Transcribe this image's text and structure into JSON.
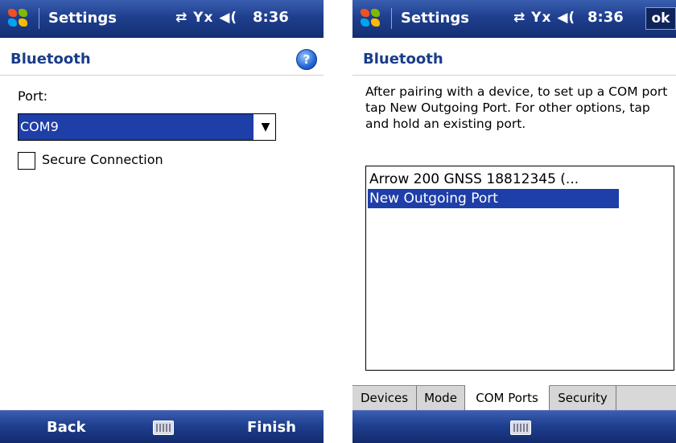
{
  "left": {
    "title": "Settings",
    "status_icons": "⇄ Yx ◀(",
    "time": "8:36",
    "section_title": "Bluetooth",
    "help_label": "?",
    "port_label": "Port:",
    "port_value": "COM9",
    "secure_label": "Secure Connection",
    "softkey_left": "Back",
    "softkey_right": "Finish"
  },
  "right": {
    "title": "Settings",
    "status_icons": "⇄ Yx ◀(",
    "time": "8:36",
    "ok_label": "ok",
    "section_title": "Bluetooth",
    "description": "After pairing with a device, to set up a COM port tap New Outgoing Port. For other options, tap and hold an existing port.",
    "list_items": [
      "Arrow 200 GNSS 18812345 (...",
      "New Outgoing Port"
    ],
    "tabs": [
      "Devices",
      "Mode",
      "COM Ports",
      "Security"
    ],
    "active_tab": "COM Ports"
  },
  "colors": {
    "titlebar": "#1f3f8f",
    "selection": "#1e3ea8",
    "heading": "#1a3d8a"
  },
  "icons": {
    "start": "windows-flag-icon",
    "sync": "sync-arrows-icon",
    "signal": "no-signal-icon",
    "volume": "volume-icon",
    "help": "help-icon",
    "keyboard": "keyboard-icon",
    "dropdown": "chevron-down-icon"
  }
}
